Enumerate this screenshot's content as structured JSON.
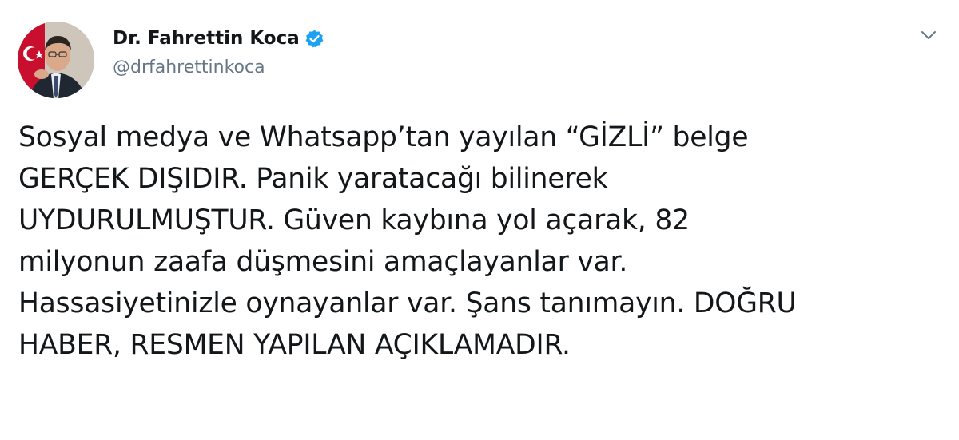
{
  "author": {
    "display_name": "Dr. Fahrettin Koca",
    "handle": "@drfahrettinkoca",
    "verified_icon": "verified-badge-icon",
    "verified_color": "#1da1f2"
  },
  "menu": {
    "icon": "chevron-down-icon"
  },
  "tweet": {
    "lines": [
      "Sosyal medya ve Whatsapp’tan yayılan “GİZLİ” belge",
      "GERÇEK DIŞIDIR. Panik yaratacağı bilinerek",
      "UYDURULMUŞTUR. Güven kaybına yol açarak, 82",
      "milyonun zaafa düşmesini amaçlayanlar var.",
      "Hassasiyetinizle oynayanlar var. Şans tanımayın. DOĞRU",
      "HABER, RESMEN YAPILAN AÇIKLAMADIR."
    ]
  }
}
